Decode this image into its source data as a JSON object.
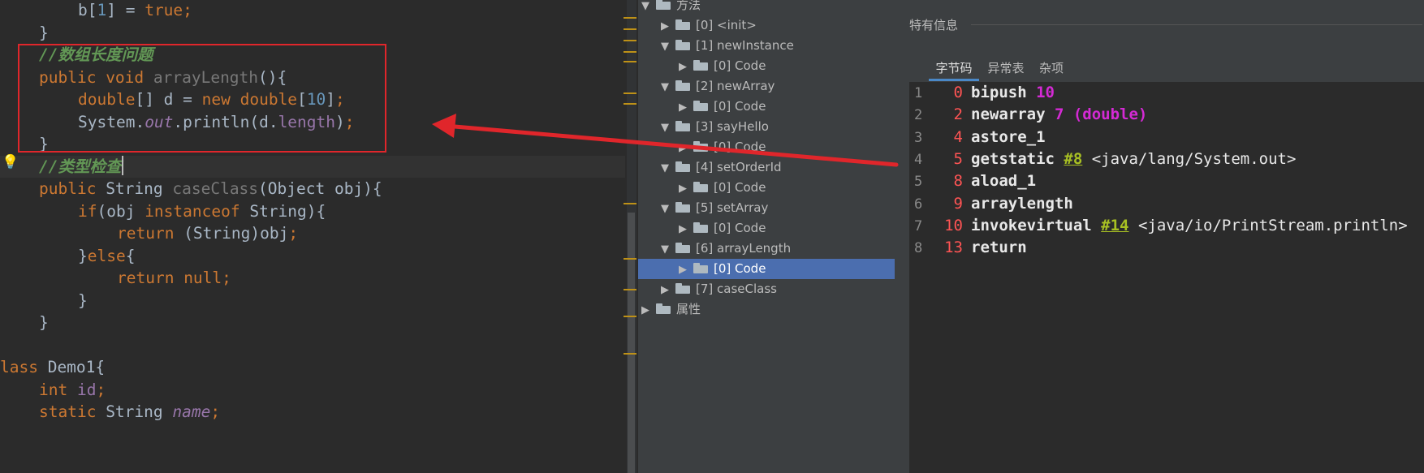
{
  "editor": {
    "lines": [
      {
        "indent": 2,
        "segs": [
          {
            "t": "b[",
            "c": "plain"
          },
          {
            "t": "1",
            "c": "num"
          },
          {
            "t": "] = ",
            "c": "plain"
          },
          {
            "t": "true",
            "c": "kw"
          },
          {
            "t": ";",
            "c": "kw"
          }
        ]
      },
      {
        "indent": 1,
        "segs": [
          {
            "t": "}",
            "c": "plain"
          }
        ]
      },
      {
        "indent": 1,
        "segs": [
          {
            "t": "//数组长度问题",
            "c": "cm"
          }
        ]
      },
      {
        "indent": 1,
        "segs": [
          {
            "t": "public ",
            "c": "kw"
          },
          {
            "t": "void ",
            "c": "kw"
          },
          {
            "t": "arrayLength",
            "c": "mdecl"
          },
          {
            "t": "(){",
            "c": "plain"
          }
        ]
      },
      {
        "indent": 2,
        "segs": [
          {
            "t": "double",
            "c": "kw"
          },
          {
            "t": "[] d = ",
            "c": "plain"
          },
          {
            "t": "new ",
            "c": "kw"
          },
          {
            "t": "double",
            "c": "kw"
          },
          {
            "t": "[",
            "c": "plain"
          },
          {
            "t": "10",
            "c": "num"
          },
          {
            "t": "]",
            "c": "plain"
          },
          {
            "t": ";",
            "c": "kw"
          }
        ]
      },
      {
        "indent": 2,
        "segs": [
          {
            "t": "System.",
            "c": "plain"
          },
          {
            "t": "out",
            "c": "ital"
          },
          {
            "t": ".println(d.",
            "c": "plain"
          },
          {
            "t": "length",
            "c": "fld"
          },
          {
            "t": ")",
            "c": "plain"
          },
          {
            "t": ";",
            "c": "kw"
          }
        ]
      },
      {
        "indent": 1,
        "segs": [
          {
            "t": "}",
            "c": "plain"
          }
        ]
      },
      {
        "indent": 1,
        "current": true,
        "segs": [
          {
            "t": "//类型检查",
            "c": "cm"
          }
        ]
      },
      {
        "indent": 1,
        "segs": [
          {
            "t": "public ",
            "c": "kw"
          },
          {
            "t": "String ",
            "c": "plain"
          },
          {
            "t": "caseClass",
            "c": "mdecl"
          },
          {
            "t": "(Object obj){",
            "c": "plain"
          }
        ]
      },
      {
        "indent": 2,
        "segs": [
          {
            "t": "if",
            "c": "kw"
          },
          {
            "t": "(obj ",
            "c": "plain"
          },
          {
            "t": "instanceof ",
            "c": "kw"
          },
          {
            "t": "String){",
            "c": "plain"
          }
        ]
      },
      {
        "indent": 3,
        "segs": [
          {
            "t": "return ",
            "c": "kw"
          },
          {
            "t": "(String)obj",
            "c": "plain"
          },
          {
            "t": ";",
            "c": "kw"
          }
        ]
      },
      {
        "indent": 2,
        "segs": [
          {
            "t": "}",
            "c": "plain"
          },
          {
            "t": "else",
            "c": "kw"
          },
          {
            "t": "{",
            "c": "plain"
          }
        ]
      },
      {
        "indent": 3,
        "segs": [
          {
            "t": "return ",
            "c": "kw"
          },
          {
            "t": "null",
            "c": "kw"
          },
          {
            "t": ";",
            "c": "kw"
          }
        ]
      },
      {
        "indent": 2,
        "segs": [
          {
            "t": "}",
            "c": "plain"
          }
        ]
      },
      {
        "indent": 1,
        "segs": [
          {
            "t": "}",
            "c": "plain"
          }
        ]
      },
      {
        "indent": 0,
        "segs": [
          {
            "t": "",
            "c": "plain"
          }
        ]
      },
      {
        "indent": 0,
        "segs": [
          {
            "t": "lass ",
            "c": "kw"
          },
          {
            "t": "Demo1{",
            "c": "plain"
          }
        ]
      },
      {
        "indent": 1,
        "segs": [
          {
            "t": "int ",
            "c": "kw"
          },
          {
            "t": "id",
            "c": "fld"
          },
          {
            "t": ";",
            "c": "kw"
          }
        ]
      },
      {
        "indent": 1,
        "segs": [
          {
            "t": "static ",
            "c": "kw"
          },
          {
            "t": "String ",
            "c": "plain"
          },
          {
            "t": "name",
            "c": "ital"
          },
          {
            "t": ";",
            "c": "kw"
          }
        ]
      }
    ]
  },
  "tree": {
    "items": [
      {
        "level": 0,
        "toggle": "expanded",
        "label": "方法"
      },
      {
        "level": 1,
        "toggle": "collapsed",
        "label": "[0] <init>"
      },
      {
        "level": 1,
        "toggle": "expanded",
        "label": "[1] newInstance"
      },
      {
        "level": 2,
        "toggle": "collapsed",
        "label": "[0] Code"
      },
      {
        "level": 1,
        "toggle": "expanded",
        "label": "[2] newArray"
      },
      {
        "level": 2,
        "toggle": "collapsed",
        "label": "[0] Code"
      },
      {
        "level": 1,
        "toggle": "expanded",
        "label": "[3] sayHello"
      },
      {
        "level": 2,
        "toggle": "collapsed",
        "label": "[0] Code"
      },
      {
        "level": 1,
        "toggle": "expanded",
        "label": "[4] setOrderId"
      },
      {
        "level": 2,
        "toggle": "collapsed",
        "label": "[0] Code"
      },
      {
        "level": 1,
        "toggle": "expanded",
        "label": "[5] setArray"
      },
      {
        "level": 2,
        "toggle": "collapsed",
        "label": "[0] Code"
      },
      {
        "level": 1,
        "toggle": "expanded",
        "label": "[6] arrayLength"
      },
      {
        "level": 2,
        "toggle": "collapsed",
        "label": "[0] Code",
        "selected": true
      },
      {
        "level": 1,
        "toggle": "collapsed",
        "label": "[7] caseClass"
      },
      {
        "level": 0,
        "toggle": "collapsed",
        "label": "属性"
      }
    ]
  },
  "info": {
    "title": "特有信息",
    "tabs": [
      {
        "label": "字节码",
        "active": true
      },
      {
        "label": "异常表",
        "active": false
      },
      {
        "label": "杂项",
        "active": false
      }
    ],
    "bytecode": [
      {
        "line": "1",
        "offset": "0",
        "op": "bipush",
        "parts": [
          {
            "t": " 10",
            "c": "arg"
          }
        ]
      },
      {
        "line": "2",
        "offset": "2",
        "op": "newarray",
        "parts": [
          {
            "t": " 7 (double)",
            "c": "arg"
          }
        ]
      },
      {
        "line": "3",
        "offset": "4",
        "op": "astore_1",
        "parts": []
      },
      {
        "line": "4",
        "offset": "5",
        "op": "getstatic",
        "parts": [
          {
            "t": " ",
            "c": "cmt"
          },
          {
            "t": "#8",
            "c": "ref"
          },
          {
            "t": " <java/lang/System.out>",
            "c": "cmt"
          }
        ]
      },
      {
        "line": "5",
        "offset": "8",
        "op": "aload_1",
        "parts": []
      },
      {
        "line": "6",
        "offset": "9",
        "op": "arraylength",
        "parts": []
      },
      {
        "line": "7",
        "offset": "10",
        "op": "invokevirtual",
        "parts": [
          {
            "t": " ",
            "c": "cmt"
          },
          {
            "t": "#14",
            "c": "ref"
          },
          {
            "t": " <java/io/PrintStream.println>",
            "c": "cmt"
          }
        ]
      },
      {
        "line": "8",
        "offset": "13",
        "op": "return",
        "parts": []
      }
    ]
  },
  "colors": {
    "annotation": "#e0262b",
    "selection": "#4b6eaf",
    "keyword": "#cc7832",
    "comment": "#629755"
  },
  "icons": {
    "tree_node": "folder-icon",
    "gutter": "bulb-icon"
  }
}
